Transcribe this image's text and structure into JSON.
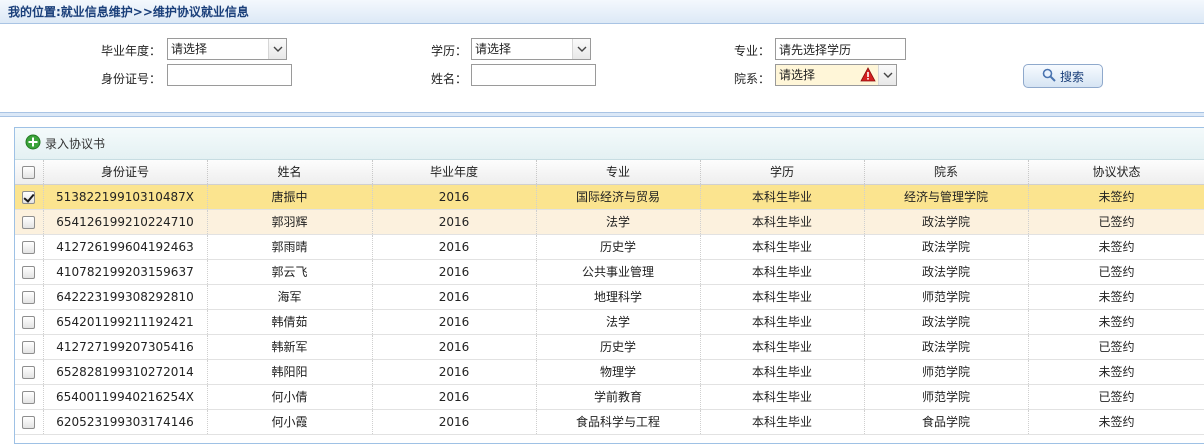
{
  "breadcrumb": {
    "text": "我的位置:就业信息维护>>维护协议就业信息"
  },
  "search": {
    "grad_year_label": "毕业年度：",
    "grad_year_value": "请选择",
    "education_label": "学历：",
    "education_value": "请选择",
    "major_label": "专业：",
    "major_value": "请先选择学历",
    "id_label": "身份证号：",
    "id_value": "",
    "name_label": "姓名：",
    "name_value": "",
    "dept_label": "院系：",
    "dept_value": "请选择",
    "search_button": "搜索"
  },
  "toolbar": {
    "add_label": "录入协议书"
  },
  "table": {
    "columns": [
      "身份证号",
      "姓名",
      "毕业年度",
      "专业",
      "学历",
      "院系",
      "协议状态"
    ],
    "rows": [
      {
        "id": "51382219910310487X",
        "name": "唐振中",
        "year": "2016",
        "major": "国际经济与贸易",
        "edu": "本科生毕业",
        "dept": "经济与管理学院",
        "status": "未签约"
      },
      {
        "id": "654126199210224710",
        "name": "郭羽辉",
        "year": "2016",
        "major": "法学",
        "edu": "本科生毕业",
        "dept": "政法学院",
        "status": "已签约"
      },
      {
        "id": "412726199604192463",
        "name": "郭雨晴",
        "year": "2016",
        "major": "历史学",
        "edu": "本科生毕业",
        "dept": "政法学院",
        "status": "未签约"
      },
      {
        "id": "410782199203159637",
        "name": "郭云飞",
        "year": "2016",
        "major": "公共事业管理",
        "edu": "本科生毕业",
        "dept": "政法学院",
        "status": "已签约"
      },
      {
        "id": "642223199308292810",
        "name": "海军",
        "year": "2016",
        "major": "地理科学",
        "edu": "本科生毕业",
        "dept": "师范学院",
        "status": "未签约"
      },
      {
        "id": "654201199211192421",
        "name": "韩倩茹",
        "year": "2016",
        "major": "法学",
        "edu": "本科生毕业",
        "dept": "政法学院",
        "status": "未签约"
      },
      {
        "id": "412727199207305416",
        "name": "韩新军",
        "year": "2016",
        "major": "历史学",
        "edu": "本科生毕业",
        "dept": "政法学院",
        "status": "已签约"
      },
      {
        "id": "652828199310272014",
        "name": "韩阳阳",
        "year": "2016",
        "major": "物理学",
        "edu": "本科生毕业",
        "dept": "师范学院",
        "status": "未签约"
      },
      {
        "id": "65400119940216254X",
        "name": "何小倩",
        "year": "2016",
        "major": "学前教育",
        "edu": "本科生毕业",
        "dept": "师范学院",
        "status": "已签约"
      },
      {
        "id": "620523199303174146",
        "name": "何小霞",
        "year": "2016",
        "major": "食品科学与工程",
        "edu": "本科生毕业",
        "dept": "食品学院",
        "status": "未签约"
      }
    ]
  },
  "colors": {
    "selected_row": "#fbe48f",
    "hover_row": "#fcf1de",
    "header_text": "#1a3f7a",
    "warning": "#d42020"
  },
  "icons": {
    "add": "add-circle-icon",
    "search": "magnifier-icon",
    "warning": "warning-triangle-icon",
    "dropdown": "chevron-down-icon"
  }
}
